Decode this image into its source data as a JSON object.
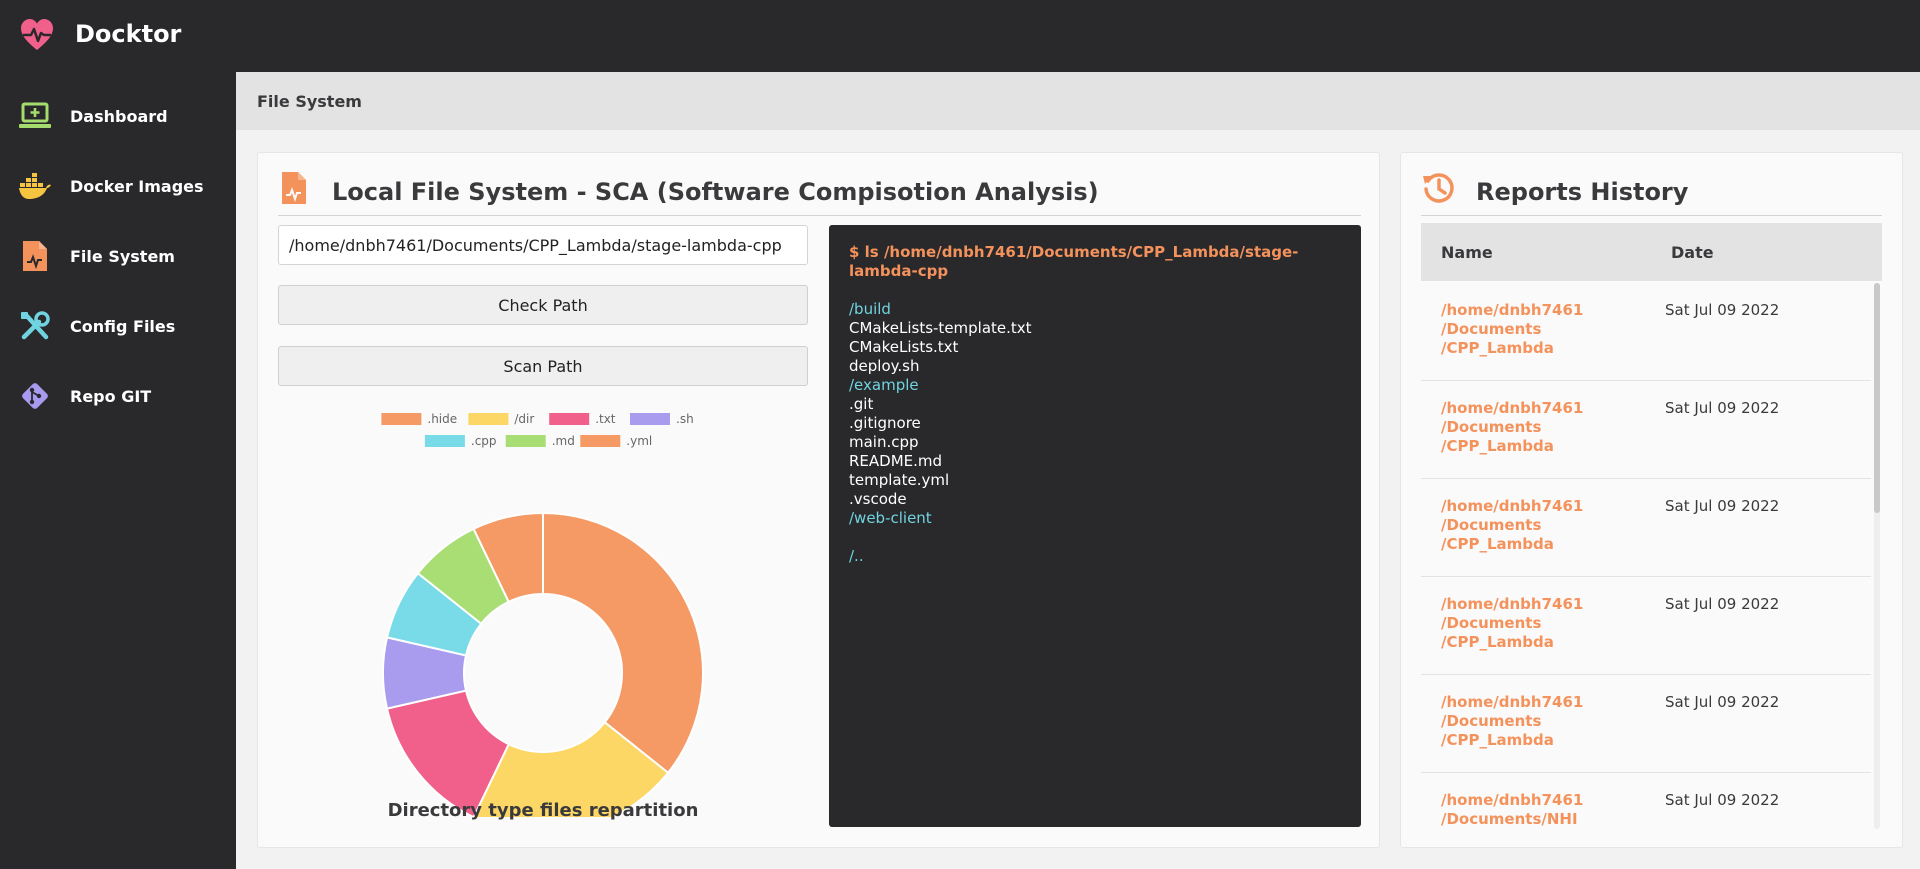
{
  "app": {
    "title": "Docktor",
    "accent": "#f4925c",
    "logo_icon": "heart-pulse-icon"
  },
  "sidebar": {
    "items": [
      {
        "label": "Dashboard",
        "icon": "laptop-plus-icon",
        "icon_color": "#a5dc6e"
      },
      {
        "label": "Docker Images",
        "icon": "docker-whale-icon",
        "icon_color": "#f5c542"
      },
      {
        "label": "File System",
        "icon": "file-chart-icon",
        "icon_color": "#f4925c"
      },
      {
        "label": "Config Files",
        "icon": "tools-icon",
        "icon_color": "#6fd4e0"
      },
      {
        "label": "Repo GIT",
        "icon": "git-icon",
        "icon_color": "#a89af0"
      }
    ]
  },
  "breadcrumb": {
    "current": "File System"
  },
  "main": {
    "title": "Local File System - SCA (Software Compisotion Analysis)",
    "title_icon": "file-chart-icon",
    "path_value": "/home/dnbh7461/Documents/CPP_Lambda/stage-lambda-cpp",
    "check_label": "Check Path",
    "scan_label": "Scan Path"
  },
  "terminal": {
    "command": "$ ls /home/dnbh7461/Documents/CPP_Lambda/stage-lambda-cpp",
    "entries": [
      {
        "text": "/build",
        "kind": "dir"
      },
      {
        "text": "CMakeLists-template.txt",
        "kind": "file"
      },
      {
        "text": "CMakeLists.txt",
        "kind": "file"
      },
      {
        "text": "deploy.sh",
        "kind": "file"
      },
      {
        "text": "/example",
        "kind": "dir"
      },
      {
        "text": ".git",
        "kind": "file"
      },
      {
        "text": ".gitignore",
        "kind": "file"
      },
      {
        "text": "main.cpp",
        "kind": "file"
      },
      {
        "text": "README.md",
        "kind": "file"
      },
      {
        "text": "template.yml",
        "kind": "file"
      },
      {
        "text": ".vscode",
        "kind": "file"
      },
      {
        "text": "/web-client",
        "kind": "dir"
      }
    ],
    "parent": "/.."
  },
  "chart_data": {
    "type": "pie",
    "variant": "doughnut",
    "title": "Directory type files repartition",
    "legend_position": "top",
    "categories": [
      ".hide",
      "/dir",
      ".txt",
      ".sh",
      ".cpp",
      ".md",
      ".yml"
    ],
    "values": [
      5,
      3,
      2,
      1,
      1,
      1,
      1
    ],
    "colors": [
      "#f59a65",
      "#fcd765",
      "#f0608a",
      "#a99bee",
      "#79dbe8",
      "#a9de74",
      "#f59a65"
    ]
  },
  "history": {
    "title": "Reports History",
    "title_icon": "history-icon",
    "col_name": "Name",
    "col_date": "Date",
    "rows": [
      {
        "name_lines": [
          "/home/dnbh7461",
          "/Documents",
          "/CPP_Lambda"
        ],
        "date": "Sat Jul 09 2022"
      },
      {
        "name_lines": [
          "/home/dnbh7461",
          "/Documents",
          "/CPP_Lambda"
        ],
        "date": "Sat Jul 09 2022"
      },
      {
        "name_lines": [
          "/home/dnbh7461",
          "/Documents",
          "/CPP_Lambda"
        ],
        "date": "Sat Jul 09 2022"
      },
      {
        "name_lines": [
          "/home/dnbh7461",
          "/Documents",
          "/CPP_Lambda"
        ],
        "date": "Sat Jul 09 2022"
      },
      {
        "name_lines": [
          "/home/dnbh7461",
          "/Documents",
          "/CPP_Lambda"
        ],
        "date": "Sat Jul 09 2022"
      },
      {
        "name_lines": [
          "/home/dnbh7461",
          "/Documents/NHI"
        ],
        "date": "Sat Jul 09 2022"
      }
    ]
  }
}
